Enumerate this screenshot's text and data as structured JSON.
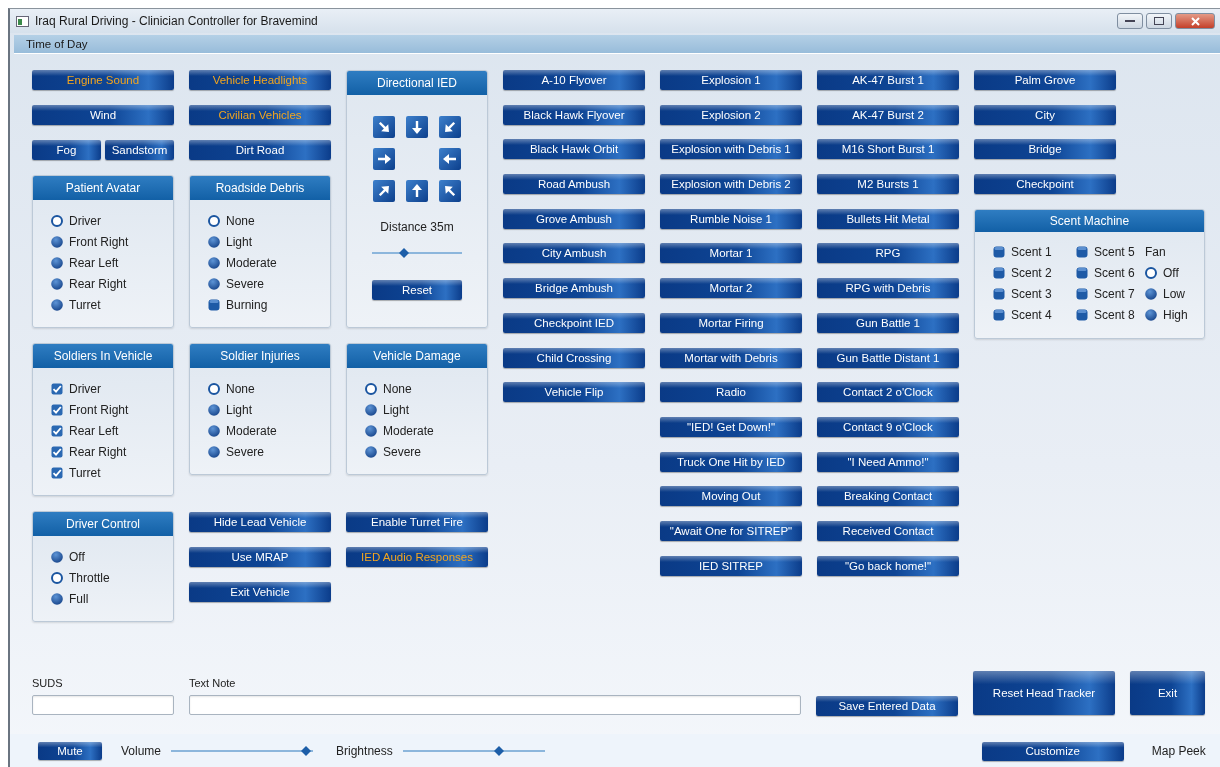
{
  "window": {
    "title": "Iraq Rural Driving - Clinician Controller for Bravemind"
  },
  "menu": [
    "Time of Day"
  ],
  "left_columns": [
    {
      "items": [
        {
          "kind": "button",
          "label": "Engine Sound",
          "on": true
        },
        {
          "kind": "button",
          "label": "Wind",
          "on": false
        },
        {
          "kind": "pair",
          "buttons": [
            {
              "label": "Fog",
              "on": false
            },
            {
              "label": "Sandstorm",
              "on": false
            }
          ]
        },
        {
          "kind": "panel",
          "title": "Patient Avatar",
          "options": [
            {
              "kind": "radio",
              "label": "Driver",
              "selected": true
            },
            {
              "kind": "radio",
              "label": "Front Right",
              "selected": false
            },
            {
              "kind": "radio",
              "label": "Rear Left",
              "selected": false
            },
            {
              "kind": "radio",
              "label": "Rear Right",
              "selected": false
            },
            {
              "kind": "radio",
              "label": "Turret",
              "selected": false
            }
          ]
        },
        {
          "kind": "panel",
          "title": "Soldiers In Vehicle",
          "options": [
            {
              "kind": "check",
              "label": "Driver",
              "checked": true
            },
            {
              "kind": "check",
              "label": "Front Right",
              "checked": true
            },
            {
              "kind": "check",
              "label": "Rear Left",
              "checked": true
            },
            {
              "kind": "check",
              "label": "Rear Right",
              "checked": true
            },
            {
              "kind": "check",
              "label": "Turret",
              "checked": true
            }
          ]
        },
        {
          "kind": "panel",
          "title": "Driver Control",
          "options": [
            {
              "kind": "radio",
              "label": "Off",
              "selected": false
            },
            {
              "kind": "radio",
              "label": "Throttle",
              "selected": true
            },
            {
              "kind": "radio",
              "label": "Full",
              "selected": false
            }
          ]
        }
      ]
    },
    {
      "items": [
        {
          "kind": "button",
          "label": "Vehicle Headlights",
          "on": true
        },
        {
          "kind": "button",
          "label": "Civilian Vehicles",
          "on": true
        },
        {
          "kind": "button",
          "label": "Dirt Road",
          "on": false
        },
        {
          "kind": "panel",
          "title": "Roadside Debris",
          "options": [
            {
              "kind": "radio",
              "label": "None",
              "selected": true
            },
            {
              "kind": "radio",
              "label": "Light",
              "selected": false
            },
            {
              "kind": "radio",
              "label": "Moderate",
              "selected": false
            },
            {
              "kind": "radio",
              "label": "Severe",
              "selected": false
            },
            {
              "kind": "check",
              "label": "Burning",
              "checked": false
            }
          ]
        },
        {
          "kind": "panel",
          "title": "Soldier Injuries",
          "options": [
            {
              "kind": "radio",
              "label": "None",
              "selected": true
            },
            {
              "kind": "radio",
              "label": "Light",
              "selected": false
            },
            {
              "kind": "radio",
              "label": "Moderate",
              "selected": false
            },
            {
              "kind": "radio",
              "label": "Severe",
              "selected": false
            }
          ]
        },
        {
          "kind": "button",
          "label": "Hide Lead Vehicle",
          "on": false
        },
        {
          "kind": "button",
          "label": "Use MRAP",
          "on": false
        },
        {
          "kind": "button",
          "label": "Exit Vehicle",
          "on": false
        }
      ]
    },
    {
      "items": [
        {
          "kind": "directional",
          "title": "Directional IED",
          "distance": "Distance 35m",
          "level": 0.36,
          "reset": "Reset"
        },
        {
          "kind": "panel",
          "title": "Vehicle Damage",
          "options": [
            {
              "kind": "radio",
              "label": "None",
              "selected": true
            },
            {
              "kind": "radio",
              "label": "Light",
              "selected": false
            },
            {
              "kind": "radio",
              "label": "Moderate",
              "selected": false
            },
            {
              "kind": "radio",
              "label": "Severe",
              "selected": false
            }
          ]
        },
        {
          "kind": "button",
          "label": "Enable Turret Fire",
          "on": false
        },
        {
          "kind": "button",
          "label": "IED Audio Responses",
          "on": true
        }
      ]
    }
  ],
  "sound_columns": [
    [
      "A-10 Flyover",
      "Black Hawk Flyover",
      "Black Hawk Orbit",
      "Road Ambush",
      "Grove Ambush",
      "City Ambush",
      "Bridge Ambush",
      "Checkpoint IED",
      "Child Crossing",
      "Vehicle Flip"
    ],
    [
      "Explosion 1",
      "Explosion 2",
      "Explosion with Debris 1",
      "Explosion with Debris 2",
      "Rumble Noise 1",
      "Mortar 1",
      "Mortar 2",
      "Mortar Firing",
      "Mortar with Debris",
      "Radio",
      "\"IED! Get Down!\"",
      "Truck One Hit by IED",
      "Moving Out",
      "\"Await One for SITREP\"",
      "IED SITREP"
    ],
    [
      "AK-47 Burst 1",
      "AK-47 Burst 2",
      "M16 Short Burst 1",
      "M2 Bursts 1",
      "Bullets Hit Metal",
      "RPG",
      "RPG with Debris",
      "Gun Battle 1",
      "Gun Battle Distant 1",
      "Contact 2 o'Clock",
      "Contact 9 o'Clock",
      "\"I Need Ammo!\"",
      "Breaking Contact",
      "Received Contact",
      "\"Go back home!\""
    ]
  ],
  "locations": [
    "Palm Grove",
    "City",
    "Bridge",
    "Checkpoint"
  ],
  "scent_machine": {
    "title": "Scent Machine",
    "scents": [
      {
        "label": "Scent 1",
        "checked": false
      },
      {
        "label": "Scent 2",
        "checked": false
      },
      {
        "label": "Scent 3",
        "checked": false
      },
      {
        "label": "Scent 4",
        "checked": false
      },
      {
        "label": "Scent 5",
        "checked": false
      },
      {
        "label": "Scent 6",
        "checked": false
      },
      {
        "label": "Scent 7",
        "checked": false
      },
      {
        "label": "Scent 8",
        "checked": false
      }
    ],
    "fan": {
      "label": "Fan",
      "options": [
        {
          "label": "Off",
          "selected": true
        },
        {
          "label": "Low",
          "selected": false
        },
        {
          "label": "High",
          "selected": false
        }
      ]
    }
  },
  "suds": {
    "label": "SUDS"
  },
  "text_note": {
    "label": "Text Note"
  },
  "save_button": "Save Entered Data",
  "reset_head_tracker_button": "Reset Head Tracker",
  "exit_button": "Exit",
  "mute_button": "Mute",
  "volume": {
    "label": "Volume",
    "level": 0.95
  },
  "brightness": {
    "label": "Brightness",
    "level": 0.68
  },
  "customize_button": "Customize",
  "map_peek": "Map Peek"
}
